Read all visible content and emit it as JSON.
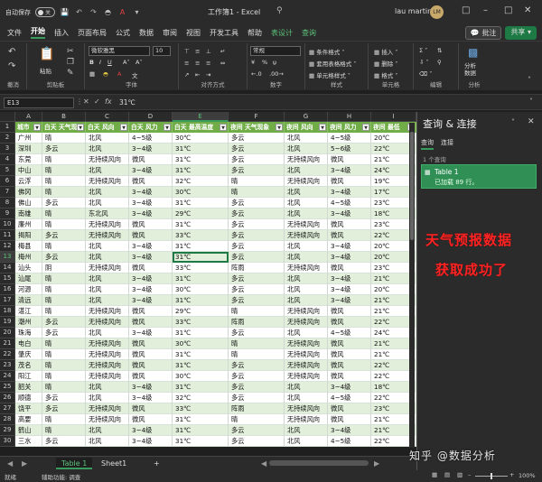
{
  "titlebar": {
    "autosave_label": "自动保存",
    "autosave_state": "关",
    "file_title": "工作簿1 - Excel",
    "user_name": "lau martin",
    "user_initials": "LM"
  },
  "menu": {
    "items": [
      "文件",
      "开始",
      "插入",
      "页面布局",
      "公式",
      "数据",
      "审阅",
      "视图",
      "开发工具",
      "帮助",
      "表设计",
      "查询"
    ],
    "active": "开始",
    "comment_label": "批注",
    "share_label": "共享"
  },
  "ribbon": {
    "groups": {
      "undo": "撤消",
      "clipboard": "剪贴板",
      "font": "字体",
      "align": "对齐方式",
      "number": "数字",
      "styles": "样式",
      "cells": "单元格",
      "edit": "编辑",
      "analysis": "分析"
    },
    "paste_label": "粘贴",
    "font_name": "微软雅黑",
    "font_size": "10",
    "number_format": "常规",
    "cond_format": "条件格式",
    "table_format": "套用表格格式",
    "cell_style": "单元格样式",
    "insert": "插入",
    "delete": "删除",
    "format": "格式",
    "analyze": "分析\n数据"
  },
  "formula": {
    "cell_ref": "E13",
    "fx": "fx",
    "value": "31℃"
  },
  "columns": [
    "A",
    "B",
    "C",
    "D",
    "E",
    "F",
    "G",
    "H",
    "I"
  ],
  "headers": [
    "城市",
    "白天 天气现象",
    "白天 风向",
    "白天 风力",
    "白天 最高温度",
    "夜间 天气现象",
    "夜间 风向",
    "夜间 风力",
    "夜间 最低"
  ],
  "rows": [
    [
      "广州",
      "晴",
      "北风",
      "4~5级",
      "30℃",
      "多云",
      "北风",
      "4~5级",
      "20℃"
    ],
    [
      "深圳",
      "多云",
      "北风",
      "3~4级",
      "31℃",
      "多云",
      "北风",
      "5~6级",
      "22℃"
    ],
    [
      "东莞",
      "晴",
      "无持续风向",
      "微风",
      "31℃",
      "多云",
      "无持续风向",
      "微风",
      "21℃"
    ],
    [
      "中山",
      "晴",
      "北风",
      "3~4级",
      "31℃",
      "多云",
      "北风",
      "3~4级",
      "24℃"
    ],
    [
      "云浮",
      "晴",
      "无持续风向",
      "微风",
      "32℃",
      "晴",
      "无持续风向",
      "微风",
      "19℃"
    ],
    [
      "佛冈",
      "晴",
      "北风",
      "3~4级",
      "30℃",
      "晴",
      "北风",
      "3~4级",
      "17℃"
    ],
    [
      "佛山",
      "多云",
      "北风",
      "3~4级",
      "31℃",
      "多云",
      "北风",
      "4~5级",
      "23℃"
    ],
    [
      "南雄",
      "晴",
      "东北风",
      "3~4级",
      "29℃",
      "多云",
      "北风",
      "3~4级",
      "18℃"
    ],
    [
      "廉州",
      "晴",
      "无持续风向",
      "微风",
      "31℃",
      "多云",
      "无持续风向",
      "微风",
      "23℃"
    ],
    [
      "揭阳",
      "多云",
      "无持续风向",
      "微风",
      "33℃",
      "多云",
      "无持续风向",
      "微风",
      "22℃"
    ],
    [
      "梅县",
      "晴",
      "北风",
      "3~4级",
      "31℃",
      "多云",
      "北风",
      "3~4级",
      "20℃"
    ],
    [
      "梅州",
      "多云",
      "北风",
      "3~4级",
      "31℃",
      "多云",
      "北风",
      "3~4级",
      "20℃"
    ],
    [
      "汕头",
      "阴",
      "无持续风向",
      "微风",
      "33℃",
      "阵雨",
      "无持续风向",
      "微风",
      "23℃"
    ],
    [
      "汕尾",
      "晴",
      "北风",
      "3~4级",
      "31℃",
      "多云",
      "北风",
      "3~4级",
      "21℃"
    ],
    [
      "河源",
      "晴",
      "北风",
      "3~4级",
      "30℃",
      "多云",
      "北风",
      "3~4级",
      "20℃"
    ],
    [
      "清远",
      "晴",
      "北风",
      "3~4级",
      "31℃",
      "多云",
      "北风",
      "3~4级",
      "21℃"
    ],
    [
      "湛江",
      "晴",
      "无持续风向",
      "微风",
      "29℃",
      "晴",
      "无持续风向",
      "微风",
      "21℃"
    ],
    [
      "潮州",
      "多云",
      "无持续风向",
      "微风",
      "33℃",
      "阵雨",
      "无持续风向",
      "微风",
      "22℃"
    ],
    [
      "珠海",
      "多云",
      "北风",
      "3~4级",
      "31℃",
      "多云",
      "北风",
      "4~5级",
      "24℃"
    ],
    [
      "电白",
      "晴",
      "无持续风向",
      "微风",
      "30℃",
      "晴",
      "无持续风向",
      "微风",
      "21℃"
    ],
    [
      "肇庆",
      "晴",
      "无持续风向",
      "微风",
      "31℃",
      "晴",
      "无持续风向",
      "微风",
      "21℃"
    ],
    [
      "茂名",
      "晴",
      "无持续风向",
      "微风",
      "31℃",
      "多云",
      "无持续风向",
      "微风",
      "22℃"
    ],
    [
      "阳江",
      "晴",
      "无持续风向",
      "微风",
      "30℃",
      "多云",
      "无持续风向",
      "微风",
      "22℃"
    ],
    [
      "韶关",
      "晴",
      "北风",
      "3~4级",
      "31℃",
      "多云",
      "北风",
      "3~4级",
      "18℃"
    ],
    [
      "顺德",
      "多云",
      "北风",
      "3~4级",
      "32℃",
      "多云",
      "北风",
      "4~5级",
      "22℃"
    ],
    [
      "饶平",
      "多云",
      "无持续风向",
      "微风",
      "33℃",
      "阵雨",
      "无持续风向",
      "微风",
      "23℃"
    ],
    [
      "高要",
      "晴",
      "无持续风向",
      "微风",
      "31℃",
      "晴",
      "无持续风向",
      "微风",
      "21℃"
    ],
    [
      "鹤山",
      "晴",
      "北风",
      "3~4级",
      "31℃",
      "多云",
      "北风",
      "3~4级",
      "21℃"
    ],
    [
      "三水",
      "多云",
      "北风",
      "3~4级",
      "31℃",
      "多云",
      "北风",
      "4~5级",
      "22℃"
    ]
  ],
  "selected": {
    "row": 13,
    "col": 4
  },
  "sheets": [
    "Table 1",
    "Sheet1"
  ],
  "status": {
    "ready": "就绪",
    "accessibility": "辅助功能: 调查",
    "zoom": "100%"
  },
  "pane": {
    "title": "查询 & 连接",
    "tab_queries": "查询",
    "tab_connections": "连接",
    "count": "1 个查询",
    "query_name": "Table 1",
    "query_status": "已加载 89 行。"
  },
  "overlay": {
    "line1": "天气预报数据",
    "line2": "获取成功了"
  },
  "watermark": "知乎 @数据分析"
}
